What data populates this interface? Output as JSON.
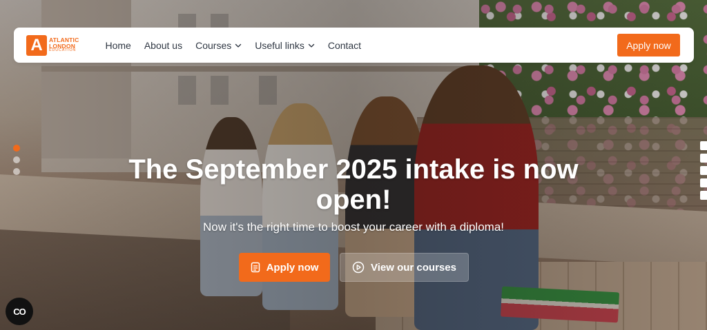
{
  "brand": {
    "mark": "A",
    "line1": "ATLANTIC",
    "line2": "LONDON",
    "line3": "EDUCATION",
    "accent_color": "#f26a1b"
  },
  "nav": {
    "items": [
      {
        "label": "Home",
        "has_dropdown": false
      },
      {
        "label": "About us",
        "has_dropdown": false
      },
      {
        "label": "Courses",
        "has_dropdown": true
      },
      {
        "label": "Useful links",
        "has_dropdown": true
      },
      {
        "label": "Contact",
        "has_dropdown": false
      }
    ],
    "apply_label": "Apply now"
  },
  "hero": {
    "headline": "The September 2025 intake is now open!",
    "subline": "Now it's the right time to boost your career with a diploma!",
    "primary_cta": {
      "label": "Apply now",
      "icon": "document-icon"
    },
    "secondary_cta": {
      "label": "View our courses",
      "icon": "play-circle-icon"
    }
  },
  "slider": {
    "count": 3,
    "active_index": 0
  },
  "consent": {
    "label": "CO"
  }
}
